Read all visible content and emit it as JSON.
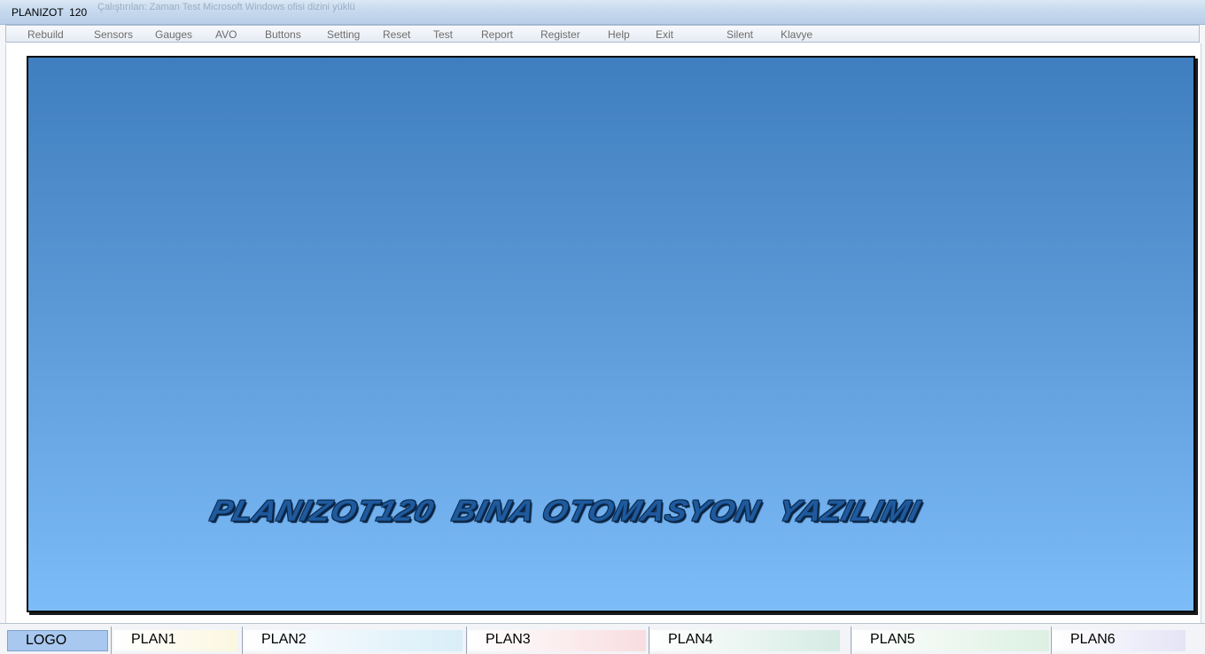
{
  "window": {
    "title": "PLANIZOT  120",
    "ghost_title": "Çalıştırılan: Zaman Test Microsoft Windows ofisi dizini yüklü"
  },
  "menu": {
    "items": [
      {
        "label": "Rebuild"
      },
      {
        "label": "Sensors"
      },
      {
        "label": "Gauges"
      },
      {
        "label": "AVO"
      },
      {
        "label": "Buttons"
      },
      {
        "label": "Setting"
      },
      {
        "label": "Reset"
      },
      {
        "label": "Test"
      },
      {
        "label": "Report"
      },
      {
        "label": "Register"
      },
      {
        "label": "Help"
      },
      {
        "label": "Exit"
      },
      {
        "label": "Silent"
      },
      {
        "label": "Klavye"
      }
    ]
  },
  "main": {
    "banner_text": "PLANIZOT120  BINA OTOMASYON  YAZILIMI",
    "panel_gradient_top": "#3f7ebf",
    "panel_gradient_bottom": "#7cbcf9"
  },
  "tabs": [
    {
      "label": "LOGO",
      "color": "#a9c8ef",
      "active": true
    },
    {
      "label": "PLAN1",
      "color": "#fbf7e0"
    },
    {
      "label": "PLAN2",
      "color": "#d8eef8"
    },
    {
      "label": "PLAN3",
      "color": "#f8dde0"
    },
    {
      "label": "PLAN4",
      "color": "#d6ebe4"
    },
    {
      "label": "PLAN5",
      "color": "#dcf0e2"
    },
    {
      "label": "PLAN6",
      "color": "#e4e4f6"
    }
  ]
}
